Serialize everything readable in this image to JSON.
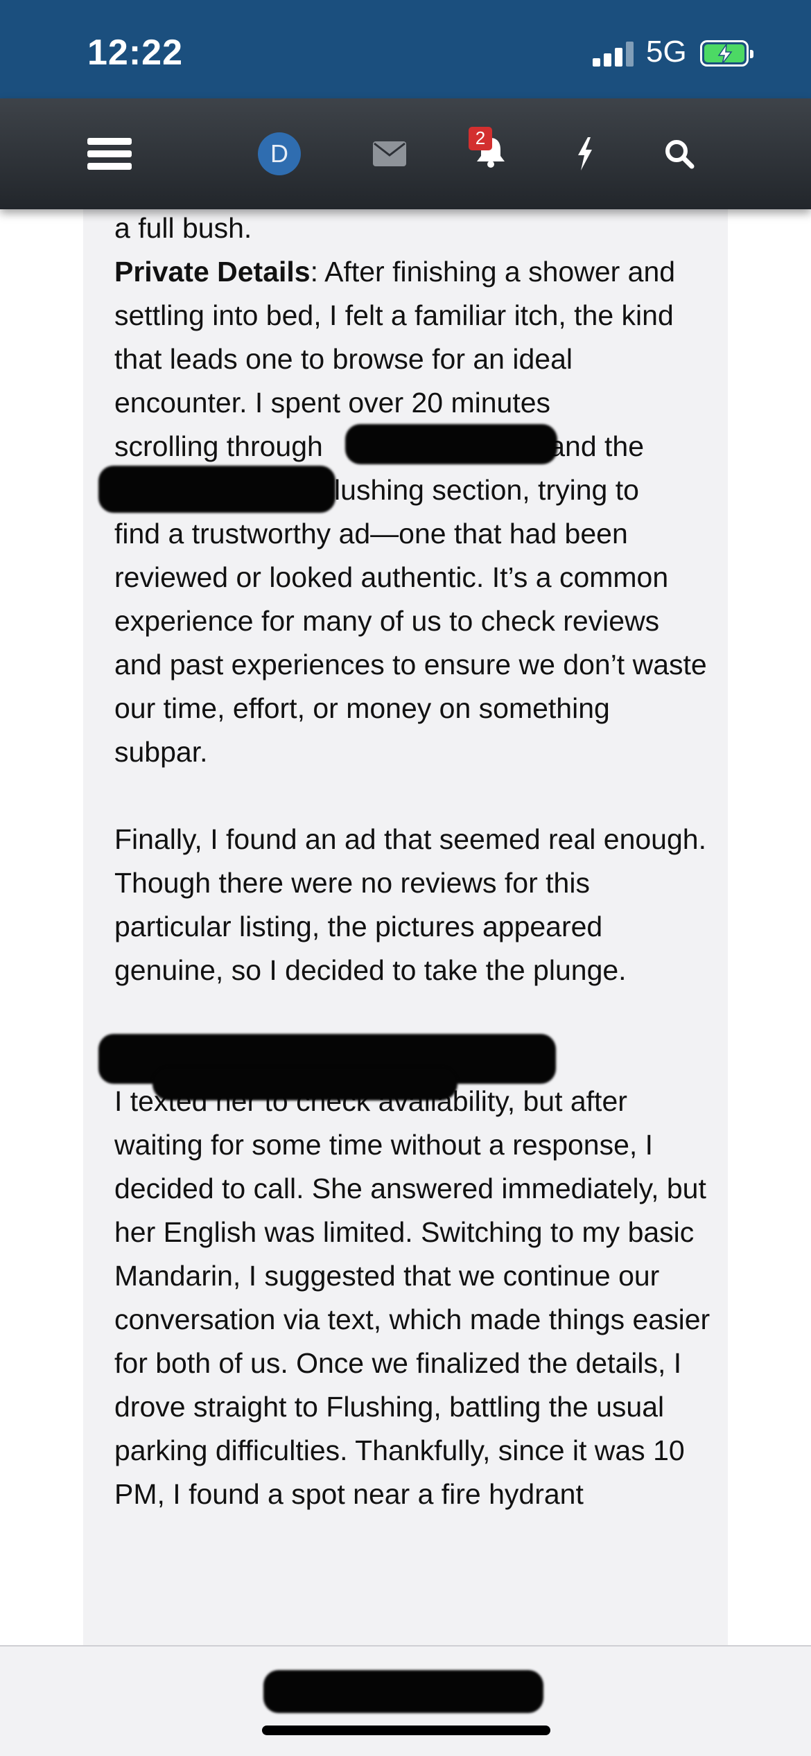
{
  "status_bar": {
    "time": "12:22",
    "network": "5G"
  },
  "nav": {
    "avatar_letter": "D",
    "notification_count": "2",
    "icons": [
      "menu-icon",
      "avatar",
      "mail-icon",
      "bell-icon",
      "bolt-icon",
      "search-icon"
    ]
  },
  "post": {
    "top_line": "a full bush.",
    "label": "Private Details",
    "p1_rest": ": After finishing a shower and settling into bed, I felt a familiar itch, the kind that leads one to browse for an ideal encounter. I spent over 20 minutes",
    "p1_scroll_prefix": "scrolling through",
    "p1_scroll_suffix": " and the",
    "p1_flushing_rest": "Flushing section, trying to",
    "p1_end": "find a trustworthy ad—one that had been reviewed or looked authentic. It’s a common experience for many of us to check reviews and past experiences to ensure we don’t waste our time, effort, or money on something subpar.",
    "p2": "Finally, I found an ad that seemed real enough. Though there were no reviews for this particular listing, the pictures appeared genuine, so I decided to take the plunge.",
    "p3": "I texted her to check availability, but after waiting for some time without a response, I decided to call. She answered immediately, but her English was limited. Switching to my basic Mandarin, I suggested that we continue our conversation via text, which made things easier for both of us. Once we finalized the details, I drove straight to Flushing, battling the usual parking difficulties. Thankfully, since it was 10 PM, I found a spot near a fire hydrant"
  },
  "colors": {
    "status_bar": "#1b4f7e",
    "nav_bar": "#2c3036",
    "card": "#f2f2f4",
    "badge": "#d32f2f",
    "avatar": "#2f6db0"
  }
}
